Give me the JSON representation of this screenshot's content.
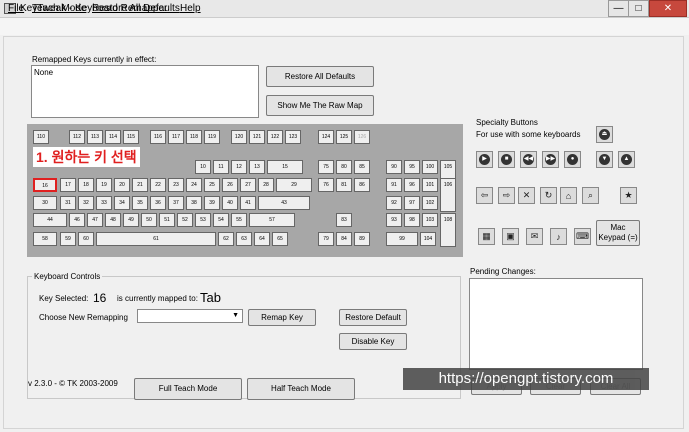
{
  "window": {
    "title": "KeyTweak -  Keyboard Remapper",
    "min_glyph": "—",
    "max_glyph": "□",
    "close_glyph": "✕"
  },
  "menu": {
    "file": "File",
    "teach": "Teach Mode",
    "restore": "Restore All Defaults",
    "help": "Help"
  },
  "remapped": {
    "label": "Remapped Keys currently in effect:",
    "value": "None"
  },
  "buttons": {
    "restore_all": "Restore All Defaults",
    "raw_map": "Show Me The Raw Map",
    "remap_key": "Remap Key",
    "restore_default": "Restore Default",
    "disable_key": "Disable Key",
    "full_teach": "Full Teach Mode",
    "half_teach": "Half Teach Mode",
    "apply": "Apply",
    "clear": "Clear",
    "clear_all": "Clear All"
  },
  "callout": "1. 원하는 키 선택",
  "keyboard_rows": [
    [
      [
        "110",
        ""
      ],
      [
        "112",
        ""
      ],
      [
        "113",
        ""
      ],
      [
        "114",
        ""
      ],
      [
        "115",
        ""
      ],
      [
        "116",
        ""
      ],
      [
        "117",
        ""
      ],
      [
        "118",
        ""
      ],
      [
        "119",
        ""
      ],
      [
        "120",
        ""
      ],
      [
        "121",
        ""
      ],
      [
        "122",
        ""
      ],
      [
        "123",
        ""
      ],
      [
        "124",
        ""
      ],
      [
        "125",
        ""
      ],
      [
        "126",
        "dis"
      ]
    ],
    [
      [
        "10",
        ""
      ],
      [
        "11",
        ""
      ],
      [
        "12",
        ""
      ],
      [
        "13",
        ""
      ],
      [
        "15",
        ""
      ],
      [
        "75",
        ""
      ],
      [
        "80",
        ""
      ],
      [
        "85",
        ""
      ],
      [
        "90",
        ""
      ],
      [
        "95",
        ""
      ],
      [
        "100",
        ""
      ],
      [
        "105",
        ""
      ]
    ],
    [
      [
        "16",
        "sel"
      ],
      [
        "17",
        ""
      ],
      [
        "18",
        ""
      ],
      [
        "19",
        ""
      ],
      [
        "20",
        ""
      ],
      [
        "21",
        ""
      ],
      [
        "22",
        ""
      ],
      [
        "23",
        ""
      ],
      [
        "24",
        ""
      ],
      [
        "25",
        ""
      ],
      [
        "26",
        ""
      ],
      [
        "27",
        ""
      ],
      [
        "28",
        ""
      ],
      [
        "29",
        ""
      ],
      [
        "76",
        ""
      ],
      [
        "81",
        ""
      ],
      [
        "86",
        ""
      ],
      [
        "91",
        ""
      ],
      [
        "96",
        ""
      ],
      [
        "101",
        ""
      ],
      [
        "106",
        ""
      ]
    ],
    [
      [
        "30",
        ""
      ],
      [
        "31",
        ""
      ],
      [
        "32",
        ""
      ],
      [
        "33",
        ""
      ],
      [
        "34",
        ""
      ],
      [
        "35",
        ""
      ],
      [
        "36",
        ""
      ],
      [
        "37",
        ""
      ],
      [
        "38",
        ""
      ],
      [
        "39",
        ""
      ],
      [
        "40",
        ""
      ],
      [
        "41",
        ""
      ],
      [
        "43",
        ""
      ],
      [
        "92",
        ""
      ],
      [
        "97",
        ""
      ],
      [
        "102",
        ""
      ]
    ],
    [
      [
        "44",
        ""
      ],
      [
        "46",
        ""
      ],
      [
        "47",
        ""
      ],
      [
        "48",
        ""
      ],
      [
        "49",
        ""
      ],
      [
        "50",
        ""
      ],
      [
        "51",
        ""
      ],
      [
        "52",
        ""
      ],
      [
        "53",
        ""
      ],
      [
        "54",
        ""
      ],
      [
        "55",
        ""
      ],
      [
        "57",
        ""
      ],
      [
        "83",
        ""
      ],
      [
        "93",
        ""
      ],
      [
        "98",
        ""
      ],
      [
        "103",
        ""
      ],
      [
        "108",
        ""
      ]
    ],
    [
      [
        "58",
        ""
      ],
      [
        "59",
        ""
      ],
      [
        "60",
        ""
      ],
      [
        "61",
        ""
      ],
      [
        "62",
        ""
      ],
      [
        "63",
        ""
      ],
      [
        "64",
        ""
      ],
      [
        "65",
        ""
      ],
      [
        "79",
        ""
      ],
      [
        "84",
        ""
      ],
      [
        "89",
        ""
      ],
      [
        "99",
        ""
      ],
      [
        "104",
        ""
      ]
    ]
  ],
  "specialty": {
    "label": "Specialty Buttons",
    "sub": "For use with some keyboards",
    "mac_line1": "Mac",
    "mac_line2": "Keypad (=)",
    "icons": [
      "eject-icon",
      "play-icon",
      "stop-icon",
      "prev-track-icon",
      "next-track-icon",
      "mute-icon",
      "volume-down-icon",
      "volume-up-icon",
      "back-icon",
      "forward-icon",
      "stop-web-icon",
      "refresh-icon",
      "home-icon",
      "search-icon",
      "favorites-icon",
      "calculator-icon",
      "mycomputer-icon",
      "email-icon",
      "media-icon",
      "keyboard-icon",
      "magnifier-icon"
    ]
  },
  "controls": {
    "title": "Keyboard Controls",
    "key_selected_label": "Key Selected:",
    "key_selected": "16",
    "mapped_label": "is currently mapped to:",
    "mapped": "Tab",
    "choose_label": "Choose New Remapping"
  },
  "version": "v 2.3.0 - © TK 2003-2009",
  "pending": {
    "label": "Pending Changes:"
  },
  "watermark": "https://opengpt.tistory.com"
}
